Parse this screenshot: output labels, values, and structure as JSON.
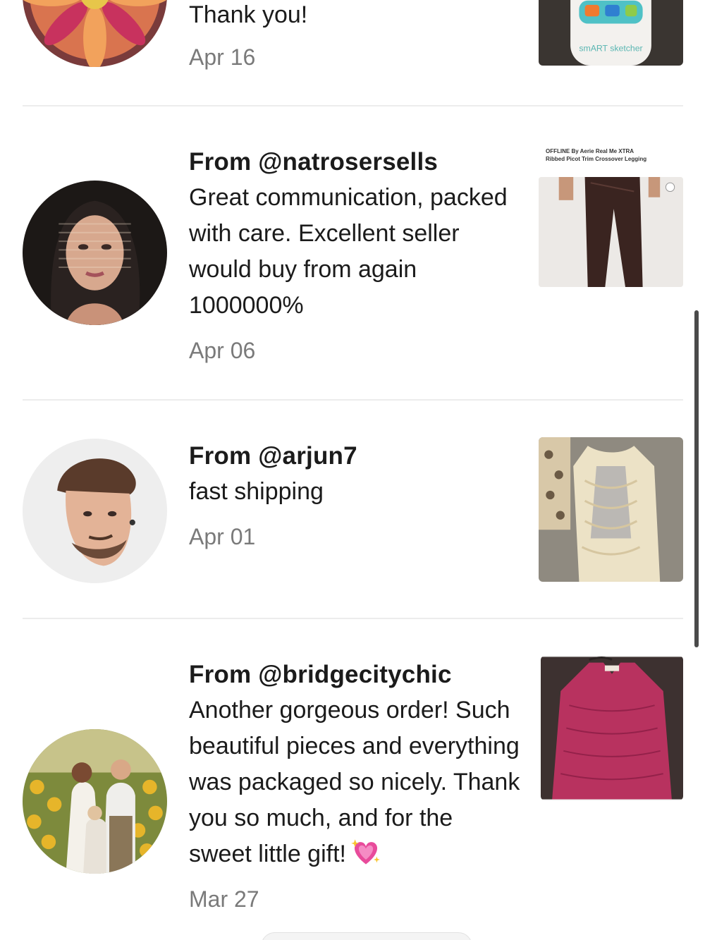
{
  "reviews": [
    {
      "from": "",
      "comment": "Thank you!",
      "date": "Apr 16",
      "avatar_icon": "flower-photo",
      "thumb_icon": "smart-sketcher-toy-photo",
      "thumb_caption": "smART sketcher"
    },
    {
      "from": "From @natrosersells",
      "comment": "Great communication, packed with care. Excellent seller would buy from again 1000000%",
      "date": "Apr 06",
      "avatar_icon": "woman-portrait-photo",
      "thumb_icon": "leggings-photo",
      "thumb_caption": "OFFLINE By Aerie Real Me XTRA Ribbed Picot Trim Crossover Legging"
    },
    {
      "from": "From @arjun7",
      "comment": "fast shipping",
      "date": "Apr 01",
      "avatar_icon": "man-portrait-photo",
      "thumb_icon": "lace-top-photo"
    },
    {
      "from": "From @bridgecitychic",
      "comment": "Another gorgeous order! Such beautiful pieces and everything was packaged so nicely. Thank you so much, and for the sweet little gift!",
      "date": "Mar 27",
      "avatar_icon": "family-photo",
      "thumb_icon": "pink-blouse-photo",
      "emoji": "sparkling-heart-icon"
    }
  ],
  "colors": {
    "text": "#1b1b1b",
    "date": "#7a7a7a",
    "divider": "#ececec"
  }
}
